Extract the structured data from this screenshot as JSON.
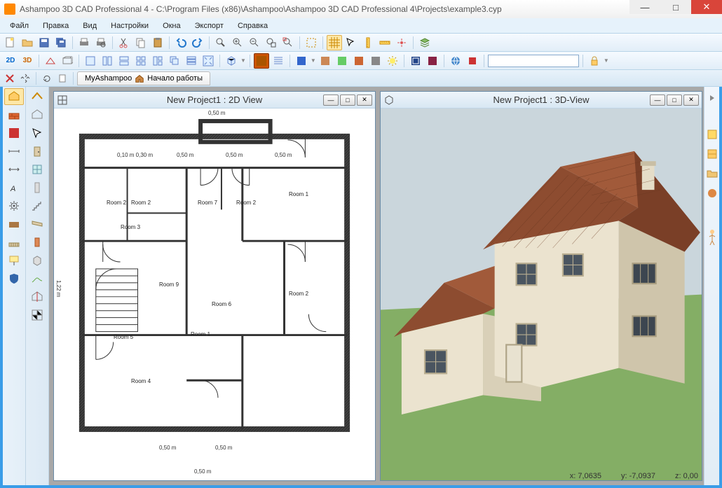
{
  "window": {
    "title": "Ashampoo 3D CAD Professional 4 - C:\\Program Files (x86)\\Ashampoo\\Ashampoo 3D CAD Professional 4\\Projects\\example3.cyp"
  },
  "menu": {
    "file": "Файл",
    "edit": "Правка",
    "view": "Вид",
    "settings": "Настройки",
    "windows": "Окна",
    "export": "Экспорт",
    "help": "Справка"
  },
  "tabs": {
    "myashampoo": "MyAshampoo",
    "start": "Начало работы"
  },
  "mdi": {
    "view2d_title": "New Project1 : 2D View",
    "view3d_title": "New Project1 : 3D-View"
  },
  "floorplan": {
    "dims": {
      "top1": "0,50 m",
      "top2": "0,50 m",
      "top3": "0,50 m",
      "left_h": "1,22 m",
      "small": "0,10 m 0,30 m"
    },
    "rooms": {
      "r1": "Room 1",
      "r2a": "Room 2",
      "r2b": "Room 2",
      "r3": "Room 3",
      "r4": "Room 4",
      "r5": "Room 5",
      "r6": "Room 6",
      "r7": "Room 7",
      "r9": "Room 9",
      "rb1": "Room 1"
    }
  },
  "status": {
    "x_label": "x:",
    "x_val": "7,0635",
    "y_label": "y:",
    "y_val": "-7,0937",
    "z_label": "z:",
    "z_val": "0,00"
  },
  "colors": {
    "accent": "#3a9de8",
    "roof": "#8c4a2e",
    "wall": "#ede5d0",
    "grass": "#7aa85e",
    "sky": "#c8d8e0"
  }
}
